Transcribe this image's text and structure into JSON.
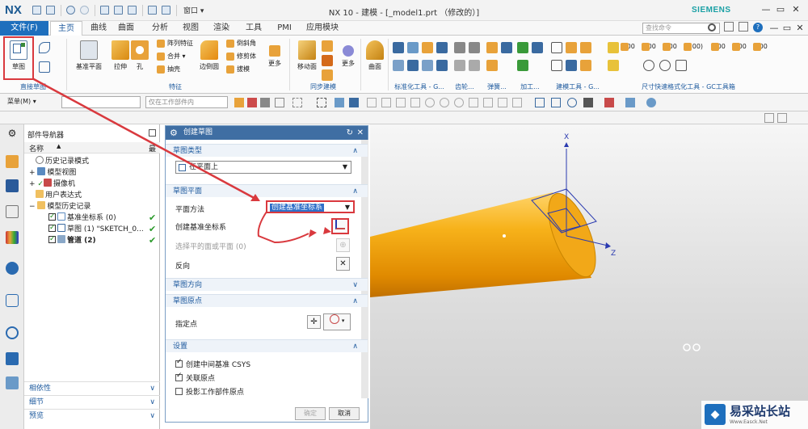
{
  "titlebar": {
    "logo": "NX",
    "window_menu": "窗口",
    "title": "NX 10 - 建模 - [_model1.prt （修改的）]",
    "brand": "SIEMENS",
    "minimize": "—",
    "restore": "▭",
    "close": "✕"
  },
  "ribbon_tabs": {
    "file": "文件(F)",
    "items": [
      "主页",
      "曲线",
      "曲面",
      "分析",
      "视图",
      "渲染",
      "工具",
      "PMI",
      "应用模块"
    ],
    "search_placeholder": "查找命令"
  },
  "ribbon": {
    "sketch": "草图",
    "direct_sketch_group": "直接草图",
    "datum_plane": "基准平面",
    "extrude": "拉伸",
    "hole": "孔",
    "pattern_feature": "阵列特征",
    "unite": "合并",
    "shell": "抽壳",
    "edge_blend": "边倒圆",
    "chamfer": "倒斜角",
    "trim_body": "修剪体",
    "draft": "拔模",
    "more": "更多",
    "feature_group": "特征",
    "move_face": "移动面",
    "sync_group": "同步建模",
    "more2": "更多",
    "surface": "曲面",
    "std_tools_group": "标准化工具 - G...",
    "gear_group": "齿轮...",
    "spring_group": "弹簧...",
    "machining_group": "加工...",
    "modeling_tools_group": "建模工具 - G...",
    "dim_tools_group": "尺寸快速格式化工具 - GC工具箱",
    "dim_values": [
      "1.00",
      "1.00",
      "1.00",
      "(1.00)",
      "1.00",
      "1.00",
      "1.00"
    ]
  },
  "selbar": {
    "menu": "菜单(M)",
    "filter_placeholder": "",
    "scope": "仅在工作部件内"
  },
  "navigator": {
    "title": "部件导航器",
    "col_name": "名称",
    "col_latest": "最",
    "rows": [
      {
        "label": "历史记录模式"
      },
      {
        "label": "模型视图"
      },
      {
        "label": "摄像机"
      },
      {
        "label": "用户表达式"
      },
      {
        "label": "模型历史记录"
      },
      {
        "label": "基准坐标系 (0)"
      },
      {
        "label": "草图 (1) \"SKETCH_0..."
      },
      {
        "label": "管道 (2)"
      }
    ],
    "footers": [
      "相依性",
      "细节",
      "预览"
    ]
  },
  "dialog": {
    "title": "创建草图",
    "sec_type": "草图类型",
    "type_value": "在平面上",
    "sec_plane": "草图平面",
    "plane_method_label": "平面方法",
    "plane_method_value": "创建基准坐标系",
    "create_csys_label": "创建基准坐标系",
    "select_face_label": "选择平的面或平面 (0)",
    "reverse_label": "反向",
    "sec_orientation": "草图方向",
    "sec_origin": "草图原点",
    "specify_point_label": "指定点",
    "sec_settings": "设置",
    "opt1": "创建中间基准 CSYS",
    "opt2": "关联原点",
    "opt3": "投影工作部件原点",
    "ok": "确定",
    "cancel": "取消"
  },
  "graphics": {
    "axis_x": "X",
    "axis_z": "Z",
    "pipe_color": "#f3a20a"
  },
  "watermark": {
    "text": "易采站长站",
    "sub": "Www.Easck.Net"
  },
  "colors": {
    "accent": "#1e6fbd",
    "annotation": "#d9393e"
  }
}
